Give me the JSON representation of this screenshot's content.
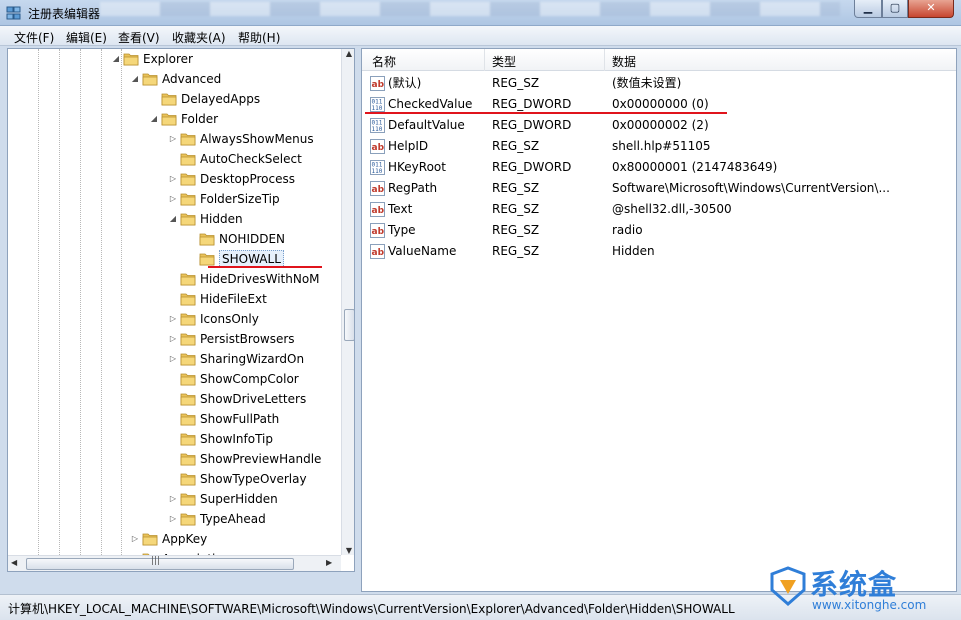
{
  "window": {
    "title": "注册表编辑器"
  },
  "menu": [
    "文件(F)",
    "编辑(E)",
    "查看(V)",
    "收藏夹(A)",
    "帮助(H)"
  ],
  "tree": {
    "nodes": [
      {
        "label": "Explorer",
        "arrow": "◢"
      },
      {
        "label": "Advanced",
        "arrow": "◢"
      },
      {
        "label": "DelayedApps",
        "arrow": ""
      },
      {
        "label": "Folder",
        "arrow": "◢"
      },
      {
        "label": "AlwaysShowMenus",
        "arrow": "▷"
      },
      {
        "label": "AutoCheckSelect",
        "arrow": ""
      },
      {
        "label": "DesktopProcess",
        "arrow": "▷"
      },
      {
        "label": "FolderSizeTip",
        "arrow": "▷"
      },
      {
        "label": "Hidden",
        "arrow": "◢"
      },
      {
        "label": "NOHIDDEN",
        "arrow": ""
      },
      {
        "label": "SHOWALL",
        "arrow": "",
        "selected": true
      },
      {
        "label": "HideDrivesWithNoM",
        "arrow": ""
      },
      {
        "label": "HideFileExt",
        "arrow": ""
      },
      {
        "label": "IconsOnly",
        "arrow": "▷"
      },
      {
        "label": "PersistBrowsers",
        "arrow": "▷"
      },
      {
        "label": "SharingWizardOn",
        "arrow": "▷"
      },
      {
        "label": "ShowCompColor",
        "arrow": ""
      },
      {
        "label": "ShowDriveLetters",
        "arrow": ""
      },
      {
        "label": "ShowFullPath",
        "arrow": ""
      },
      {
        "label": "ShowInfoTip",
        "arrow": ""
      },
      {
        "label": "ShowPreviewHandle",
        "arrow": ""
      },
      {
        "label": "ShowTypeOverlay",
        "arrow": ""
      },
      {
        "label": "SuperHidden",
        "arrow": "▷"
      },
      {
        "label": "TypeAhead",
        "arrow": "▷"
      },
      {
        "label": "AppKey",
        "arrow": "▷"
      },
      {
        "label": "Associations",
        "arrow": ""
      }
    ]
  },
  "list": {
    "columns": [
      "名称",
      "类型",
      "数据"
    ],
    "rows": [
      {
        "name": "(默认)",
        "type": "REG_SZ",
        "data": "(数值未设置)",
        "icon": "ab-string-icon"
      },
      {
        "name": "CheckedValue",
        "type": "REG_DWORD",
        "data": "0x00000000 (0)",
        "icon": "binary-dword-icon"
      },
      {
        "name": "DefaultValue",
        "type": "REG_DWORD",
        "data": "0x00000002 (2)",
        "icon": "binary-dword-icon"
      },
      {
        "name": "HelpID",
        "type": "REG_SZ",
        "data": "shell.hlp#51105",
        "icon": "ab-string-icon"
      },
      {
        "name": "HKeyRoot",
        "type": "REG_DWORD",
        "data": "0x80000001 (2147483649)",
        "icon": "binary-dword-icon"
      },
      {
        "name": "RegPath",
        "type": "REG_SZ",
        "data": "Software\\Microsoft\\Windows\\CurrentVersion\\...",
        "icon": "ab-string-icon"
      },
      {
        "name": "Text",
        "type": "REG_SZ",
        "data": "@shell32.dll,-30500",
        "icon": "ab-string-icon"
      },
      {
        "name": "Type",
        "type": "REG_SZ",
        "data": "radio",
        "icon": "ab-string-icon"
      },
      {
        "name": "ValueName",
        "type": "REG_SZ",
        "data": "Hidden",
        "icon": "ab-string-icon"
      }
    ]
  },
  "statusbar": {
    "path": "计算机\\HKEY_LOCAL_MACHINE\\SOFTWARE\\Microsoft\\Windows\\CurrentVersion\\Explorer\\Advanced\\Folder\\Hidden\\SHOWALL"
  },
  "watermark": {
    "title": "系统盒",
    "url": "www.xitonghe.com"
  },
  "colors": {
    "highlight_line": "#e0141c",
    "folder": "#e9c25a",
    "accent": "#2f7ed8"
  }
}
